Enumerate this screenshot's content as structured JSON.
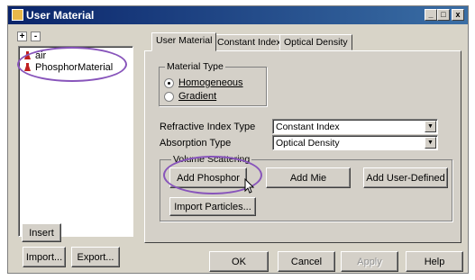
{
  "window": {
    "title": "User Material",
    "minimize": "_",
    "maximize": "□",
    "close": "x"
  },
  "tree": {
    "expand": "+",
    "collapse": "-",
    "items": [
      {
        "label": "air",
        "color": "#c02020"
      },
      {
        "label": "PhosphorMaterial",
        "color": "#c02020"
      }
    ]
  },
  "left_buttons": {
    "insert": "Insert",
    "import": "Import...",
    "export": "Export..."
  },
  "tabs": [
    {
      "label": "User Material",
      "active": true
    },
    {
      "label": "Constant Index",
      "active": false
    },
    {
      "label": "Optical Density",
      "active": false
    }
  ],
  "material_type": {
    "label": "Material Type",
    "options": [
      {
        "label": "Homogeneous",
        "selected": true
      },
      {
        "label": "Gradient",
        "selected": false
      }
    ]
  },
  "refractive_index": {
    "label": "Refractive Index Type",
    "value": "Constant Index"
  },
  "absorption": {
    "label": "Absorption Type",
    "value": "Optical Density"
  },
  "volume_scattering": {
    "label": "Volume Scattering",
    "add_phosphor": "Add Phosphor",
    "add_mie": "Add Mie",
    "add_user_defined": "Add User-Defined",
    "import_particles": "Import Particles..."
  },
  "footer": {
    "ok": "OK",
    "cancel": "Cancel",
    "apply": "Apply",
    "help": "Help"
  },
  "colors": {
    "highlight_oval": "#8855bb",
    "titlebar": "#0a246a"
  }
}
